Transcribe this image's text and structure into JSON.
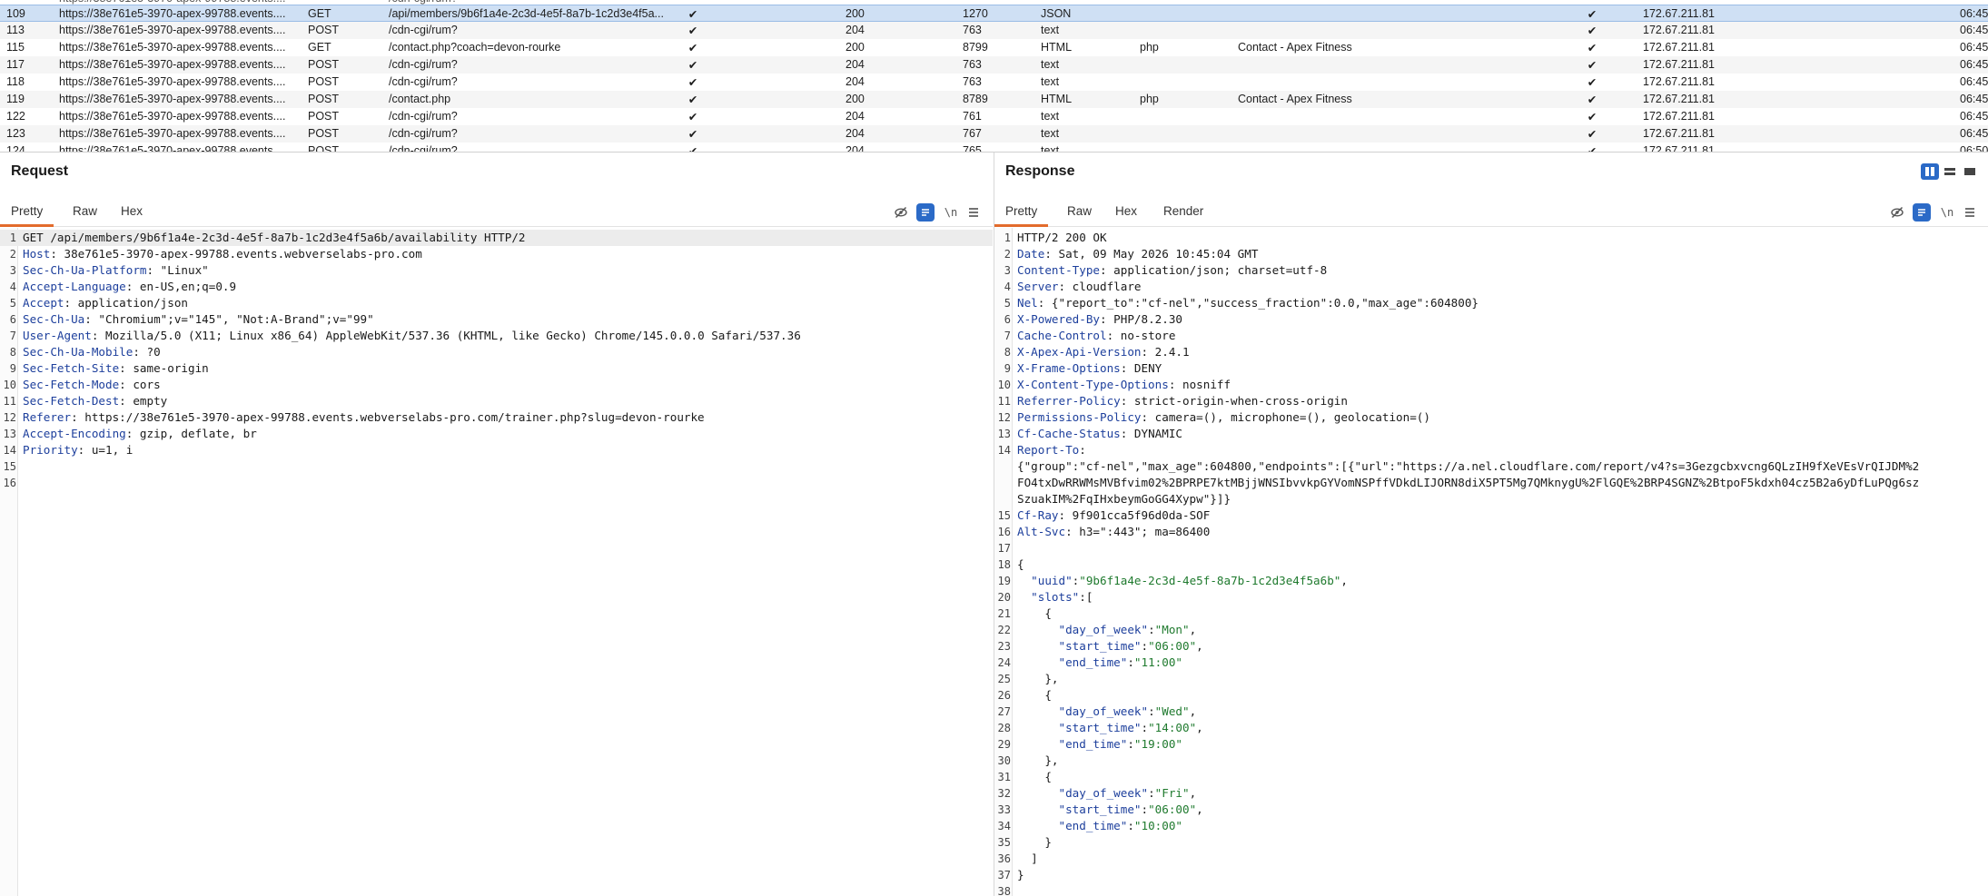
{
  "history": {
    "rows": [
      {
        "num": "109",
        "host": "https://38e761e5-3970-apex-99788.events....",
        "method": "GET",
        "url": "/api/members/9b6f1a4e-2c3d-4e5f-8a7b-1c2d3e4f5a...",
        "params": "✔",
        "status": "200",
        "length": "1270",
        "mime": "JSON",
        "ext": "",
        "title": "",
        "tls": "✔",
        "ip": "172.67.211.81",
        "time": "06:45",
        "selected": true
      },
      {
        "num": "113",
        "host": "https://38e761e5-3970-apex-99788.events....",
        "method": "POST",
        "url": "/cdn-cgi/rum?",
        "params": "✔",
        "status": "204",
        "length": "763",
        "mime": "text",
        "ext": "",
        "title": "",
        "tls": "✔",
        "ip": "172.67.211.81",
        "time": "06:45"
      },
      {
        "num": "115",
        "host": "https://38e761e5-3970-apex-99788.events....",
        "method": "GET",
        "url": "/contact.php?coach=devon-rourke",
        "params": "✔",
        "status": "200",
        "length": "8799",
        "mime": "HTML",
        "ext": "php",
        "title": "Contact - Apex Fitness",
        "tls": "✔",
        "ip": "172.67.211.81",
        "time": "06:45"
      },
      {
        "num": "117",
        "host": "https://38e761e5-3970-apex-99788.events....",
        "method": "POST",
        "url": "/cdn-cgi/rum?",
        "params": "✔",
        "status": "204",
        "length": "763",
        "mime": "text",
        "ext": "",
        "title": "",
        "tls": "✔",
        "ip": "172.67.211.81",
        "time": "06:45"
      },
      {
        "num": "118",
        "host": "https://38e761e5-3970-apex-99788.events....",
        "method": "POST",
        "url": "/cdn-cgi/rum?",
        "params": "✔",
        "status": "204",
        "length": "763",
        "mime": "text",
        "ext": "",
        "title": "",
        "tls": "✔",
        "ip": "172.67.211.81",
        "time": "06:45"
      },
      {
        "num": "119",
        "host": "https://38e761e5-3970-apex-99788.events....",
        "method": "POST",
        "url": "/contact.php",
        "params": "✔",
        "status": "200",
        "length": "8789",
        "mime": "HTML",
        "ext": "php",
        "title": "Contact - Apex Fitness",
        "tls": "✔",
        "ip": "172.67.211.81",
        "time": "06:45"
      },
      {
        "num": "122",
        "host": "https://38e761e5-3970-apex-99788.events....",
        "method": "POST",
        "url": "/cdn-cgi/rum?",
        "params": "✔",
        "status": "204",
        "length": "761",
        "mime": "text",
        "ext": "",
        "title": "",
        "tls": "✔",
        "ip": "172.67.211.81",
        "time": "06:45"
      },
      {
        "num": "123",
        "host": "https://38e761e5-3970-apex-99788.events....",
        "method": "POST",
        "url": "/cdn-cgi/rum?",
        "params": "✔",
        "status": "204",
        "length": "767",
        "mime": "text",
        "ext": "",
        "title": "",
        "tls": "✔",
        "ip": "172.67.211.81",
        "time": "06:45"
      },
      {
        "num": "124",
        "host": "https://38e761e5-3970-apex-99788.events....",
        "method": "POST",
        "url": "/cdn-cgi/rum?",
        "params": "✔",
        "status": "204",
        "length": "765",
        "mime": "text",
        "ext": "",
        "title": "",
        "tls": "✔",
        "ip": "172.67.211.81",
        "time": "06:50"
      }
    ]
  },
  "request": {
    "title": "Request",
    "tabs": [
      "Pretty",
      "Raw",
      "Hex"
    ],
    "active_tab": "Pretty",
    "lines": [
      {
        "n": "1",
        "t": "GET /api/members/9b6f1a4e-2c3d-4e5f-8a7b-1c2d3e4f5a6b/availability HTTP/2"
      },
      {
        "n": "2",
        "k": "Host",
        "v": " 38e761e5-3970-apex-99788.events.webverselabs-pro.com"
      },
      {
        "n": "3",
        "k": "Sec-Ch-Ua-Platform",
        "v": " \"Linux\""
      },
      {
        "n": "4",
        "k": "Accept-Language",
        "v": " en-US,en;q=0.9"
      },
      {
        "n": "5",
        "k": "Accept",
        "v": " application/json"
      },
      {
        "n": "6",
        "k": "Sec-Ch-Ua",
        "v": " \"Chromium\";v=\"145\", \"Not:A-Brand\";v=\"99\""
      },
      {
        "n": "7",
        "k": "User-Agent",
        "v": " Mozilla/5.0 (X11; Linux x86_64) AppleWebKit/537.36 (KHTML, like Gecko) Chrome/145.0.0.0 Safari/537.36"
      },
      {
        "n": "8",
        "k": "Sec-Ch-Ua-Mobile",
        "v": " ?0"
      },
      {
        "n": "9",
        "k": "Sec-Fetch-Site",
        "v": " same-origin"
      },
      {
        "n": "10",
        "k": "Sec-Fetch-Mode",
        "v": " cors"
      },
      {
        "n": "11",
        "k": "Sec-Fetch-Dest",
        "v": " empty"
      },
      {
        "n": "12",
        "k": "Referer",
        "v": " https://38e761e5-3970-apex-99788.events.webverselabs-pro.com/trainer.php?slug=devon-rourke"
      },
      {
        "n": "13",
        "k": "Accept-Encoding",
        "v": " gzip, deflate, br"
      },
      {
        "n": "14",
        "k": "Priority",
        "v": " u=1, i"
      },
      {
        "n": "15",
        "t": ""
      },
      {
        "n": "16",
        "t": ""
      }
    ]
  },
  "response": {
    "title": "Response",
    "tabs": [
      "Pretty",
      "Raw",
      "Hex",
      "Render"
    ],
    "active_tab": "Pretty",
    "lines": [
      {
        "n": "1",
        "t": "HTTP/2 200 OK"
      },
      {
        "n": "2",
        "k": "Date",
        "v": " Sat, 09 May 2026 10:45:04 GMT"
      },
      {
        "n": "3",
        "k": "Content-Type",
        "v": " application/json; charset=utf-8"
      },
      {
        "n": "4",
        "k": "Server",
        "v": " cloudflare"
      },
      {
        "n": "5",
        "k": "Nel",
        "v": " {\"report_to\":\"cf-nel\",\"success_fraction\":0.0,\"max_age\":604800}"
      },
      {
        "n": "6",
        "k": "X-Powered-By",
        "v": " PHP/8.2.30"
      },
      {
        "n": "7",
        "k": "Cache-Control",
        "v": " no-store"
      },
      {
        "n": "8",
        "k": "X-Apex-Api-Version",
        "v": " 2.4.1"
      },
      {
        "n": "9",
        "k": "X-Frame-Options",
        "v": " DENY"
      },
      {
        "n": "10",
        "k": "X-Content-Type-Options",
        "v": " nosniff"
      },
      {
        "n": "11",
        "k": "Referrer-Policy",
        "v": " strict-origin-when-cross-origin"
      },
      {
        "n": "12",
        "k": "Permissions-Policy",
        "v": " camera=(), microphone=(), geolocation=()"
      },
      {
        "n": "13",
        "k": "Cf-Cache-Status",
        "v": " DYNAMIC"
      },
      {
        "n": "14",
        "k": "Report-To",
        "v": ""
      },
      {
        "n": "",
        "t": "{\"group\":\"cf-nel\",\"max_age\":604800,\"endpoints\":[{\"url\":\"https://a.nel.cloudflare.com/report/v4?s=3Gezgcbxvcng6QLzIH9fXeVEsVrQIJDM%2"
      },
      {
        "n": "",
        "t": "FO4txDwRRWMsMVBfvim02%2BPRPE7ktMBjjWNSIbvvkpGYVomNSPffVDkdLIJORN8diX5PT5Mg7QMknygU%2FlGQE%2BRP4SGNZ%2BtpoF5kdxh04cz5B2a6yDfLuPQg6sz"
      },
      {
        "n": "",
        "t": "SzuakIM%2FqIHxbeymGoGG4Xypw\"}]}"
      },
      {
        "n": "15",
        "k": "Cf-Ray",
        "v": " 9f901cca5f96d0da-SOF"
      },
      {
        "n": "16",
        "k": "Alt-Svc",
        "v": " h3=\":443\"; ma=86400"
      },
      {
        "n": "17",
        "t": ""
      },
      {
        "n": "18",
        "t": "{"
      },
      {
        "n": "19",
        "jk": "\"uuid\"",
        "jv": "\"9b6f1a4e-2c3d-4e5f-8a7b-1c2d3e4f5a6b\"",
        "ind": "  ",
        "tail": ","
      },
      {
        "n": "20",
        "jk": "\"slots\"",
        "jv": "",
        "ind": "  ",
        "tail": "["
      },
      {
        "n": "21",
        "t": "    {"
      },
      {
        "n": "22",
        "jk": "\"day_of_week\"",
        "jv": "\"Mon\"",
        "ind": "      ",
        "tail": ","
      },
      {
        "n": "23",
        "jk": "\"start_time\"",
        "jv": "\"06:00\"",
        "ind": "      ",
        "tail": ","
      },
      {
        "n": "24",
        "jk": "\"end_time\"",
        "jv": "\"11:00\"",
        "ind": "      ",
        "tail": ""
      },
      {
        "n": "25",
        "t": "    },"
      },
      {
        "n": "26",
        "t": "    {"
      },
      {
        "n": "27",
        "jk": "\"day_of_week\"",
        "jv": "\"Wed\"",
        "ind": "      ",
        "tail": ","
      },
      {
        "n": "28",
        "jk": "\"start_time\"",
        "jv": "\"14:00\"",
        "ind": "      ",
        "tail": ","
      },
      {
        "n": "29",
        "jk": "\"end_time\"",
        "jv": "\"19:00\"",
        "ind": "      ",
        "tail": ""
      },
      {
        "n": "30",
        "t": "    },"
      },
      {
        "n": "31",
        "t": "    {"
      },
      {
        "n": "32",
        "jk": "\"day_of_week\"",
        "jv": "\"Fri\"",
        "ind": "      ",
        "tail": ","
      },
      {
        "n": "33",
        "jk": "\"start_time\"",
        "jv": "\"06:00\"",
        "ind": "      ",
        "tail": ","
      },
      {
        "n": "34",
        "jk": "\"end_time\"",
        "jv": "\"10:00\"",
        "ind": "      ",
        "tail": ""
      },
      {
        "n": "35",
        "t": "    }"
      },
      {
        "n": "36",
        "t": "  ]"
      },
      {
        "n": "37",
        "t": "}"
      },
      {
        "n": "38",
        "t": ""
      }
    ]
  },
  "icons": {
    "hide": "eye-slash-icon",
    "wrap": "wrap-lines-icon",
    "newline": "\\n",
    "menu": "hamburger-menu-icon"
  },
  "colors": {
    "accent_tab": "#e36b2c",
    "selected_row": "#cfe0f4",
    "header_key": "#1d3f9c",
    "json_string": "#1f7a2e",
    "toolbar_blue": "#2b6ac7"
  }
}
